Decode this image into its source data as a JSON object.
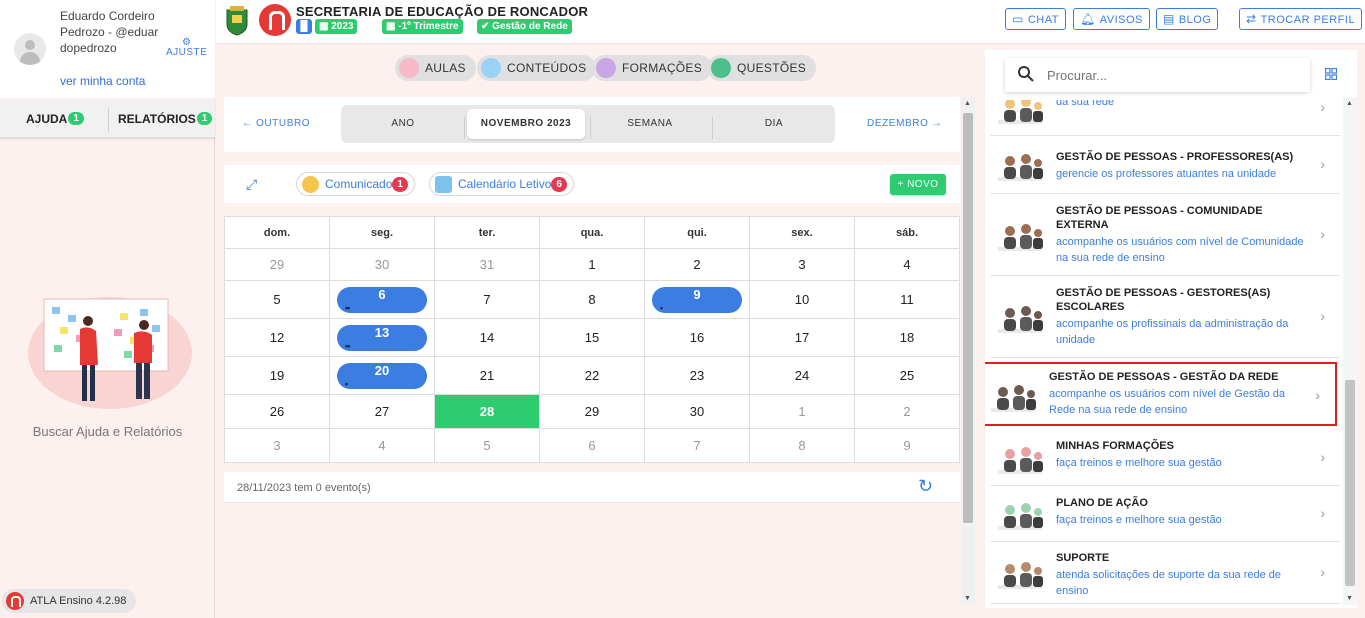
{
  "user": {
    "name": "Eduardo Cordeiro Pedrozo - @eduardopedrozo",
    "adjust_label": "AJUSTE",
    "account_link": "ver minha conta"
  },
  "left_tabs": [
    {
      "label": "AJUDA",
      "count": "1"
    },
    {
      "label": "RELATÓRIOS",
      "count": "1"
    }
  ],
  "help_caption": "Buscar Ajuda e Relatórios",
  "version": "ATLA Ensino 4.2.98",
  "header": {
    "org_title": "SECRETARIA DE EDUCAÇÃO DE RONCADOR",
    "chips": [
      "2023",
      "-1º Trimestre",
      "Gestão de Rede"
    ],
    "buttons": [
      "CHAT",
      "AVISOS",
      "BLOG",
      "TROCAR PERFIL"
    ]
  },
  "nav_pills": [
    "AULAS",
    "CONTEÚDOS",
    "FORMAÇÕES",
    "QUESTÕES"
  ],
  "calendar_nav": {
    "prev": "OUTUBRO",
    "next": "DEZEMBRO",
    "views": [
      "ANO",
      "NOVEMBRO 2023",
      "SEMANA",
      "DIA"
    ],
    "active_view": "NOVEMBRO 2023"
  },
  "filters": [
    {
      "label": "Comunicado",
      "count": "1"
    },
    {
      "label": "Calendário Letivo",
      "count": "6"
    }
  ],
  "new_button": "NOVO",
  "weekdays": [
    "dom.",
    "seg.",
    "ter.",
    "qua.",
    "qui.",
    "sex.",
    "sáb."
  ],
  "weeks": [
    [
      {
        "d": "29",
        "m": true
      },
      {
        "d": "30",
        "m": true
      },
      {
        "d": "31",
        "m": true
      },
      {
        "d": "1"
      },
      {
        "d": "2"
      },
      {
        "d": "3"
      },
      {
        "d": "4"
      }
    ],
    [
      {
        "d": "5"
      },
      {
        "d": "6",
        "ev": "••"
      },
      {
        "d": "7"
      },
      {
        "d": "8"
      },
      {
        "d": "9",
        "ev": "•"
      },
      {
        "d": "10"
      },
      {
        "d": "11"
      }
    ],
    [
      {
        "d": "12"
      },
      {
        "d": "13",
        "ev": "••"
      },
      {
        "d": "14"
      },
      {
        "d": "15"
      },
      {
        "d": "16"
      },
      {
        "d": "17"
      },
      {
        "d": "18"
      }
    ],
    [
      {
        "d": "19"
      },
      {
        "d": "20",
        "ev": "•"
      },
      {
        "d": "21"
      },
      {
        "d": "22"
      },
      {
        "d": "23"
      },
      {
        "d": "24"
      },
      {
        "d": "25"
      }
    ],
    [
      {
        "d": "26"
      },
      {
        "d": "27"
      },
      {
        "d": "28",
        "today": true
      },
      {
        "d": "29"
      },
      {
        "d": "30"
      },
      {
        "d": "1",
        "m": true
      },
      {
        "d": "2",
        "m": true
      }
    ],
    [
      {
        "d": "3",
        "m": true
      },
      {
        "d": "4",
        "m": true
      },
      {
        "d": "5",
        "m": true
      },
      {
        "d": "6",
        "m": true
      },
      {
        "d": "7",
        "m": true
      },
      {
        "d": "8",
        "m": true
      },
      {
        "d": "9",
        "m": true
      }
    ]
  ],
  "events_footer": "28/11/2023 tem 0 evento(s)",
  "search_placeholder": "Procurar...",
  "menu_items": [
    {
      "title": "",
      "subtitle": "veja detalhes do cotidiano das unidades de ensino da sua rede"
    },
    {
      "title": "GESTÃO DE PESSOAS - PROFESSORES(AS)",
      "subtitle": "gerencie os professores atuantes na unidade"
    },
    {
      "title": "GESTÃO DE PESSOAS - COMUNIDADE EXTERNA",
      "subtitle": "acompanhe os usuários com nível de Comunidade na sua rede de ensino"
    },
    {
      "title": "GESTÃO DE PESSOAS - GESTORES(AS) ESCOLARES",
      "subtitle": "acompanhe os profissinais da administração da unidade"
    },
    {
      "title": "GESTÃO DE PESSOAS - GESTÃO DA REDE",
      "subtitle": "acompanhe os usuários com nível de Gestão da Rede na sua rede de ensino"
    },
    {
      "title": "MINHAS FORMAÇÕES",
      "subtitle": "faça treinos e melhore sua gestão"
    },
    {
      "title": "PLANO DE AÇÃO",
      "subtitle": "faça treinos e melhore sua gestão"
    },
    {
      "title": "SUPORTE",
      "subtitle": "atenda solicitações de suporte da sua rede de ensino"
    }
  ],
  "colors": {
    "accent": "#3b7de0",
    "success": "#2ecc71",
    "brand": "#e53935",
    "selection": "#e02020"
  }
}
